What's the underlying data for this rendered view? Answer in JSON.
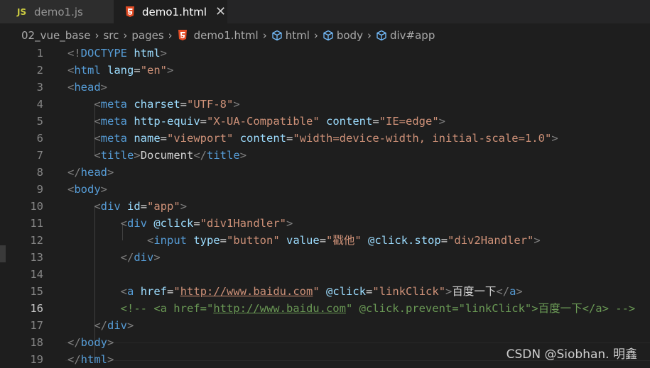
{
  "tabs": [
    {
      "icon": "JS",
      "label": "demo1.js"
    },
    {
      "icon": "html5-icon",
      "label": "demo1.html"
    }
  ],
  "breadcrumb": [
    "02_vue_base",
    "src",
    "pages",
    "demo1.html",
    "html",
    "body",
    "div#app"
  ],
  "line_numbers": [
    "1",
    "2",
    "3",
    "4",
    "5",
    "6",
    "7",
    "8",
    "9",
    "10",
    "11",
    "12",
    "13",
    "14",
    "15",
    "16",
    "17",
    "18",
    "19"
  ],
  "current_line": 16,
  "code_lines": [
    [
      [
        "t-punc",
        "<!"
      ],
      [
        "t-tag",
        "DOCTYPE"
      ],
      [
        "t-text",
        " "
      ],
      [
        "t-attr",
        "html"
      ],
      [
        "t-punc",
        ">"
      ]
    ],
    [
      [
        "t-punc",
        "<"
      ],
      [
        "t-tag",
        "html"
      ],
      [
        "t-text",
        " "
      ],
      [
        "t-attr",
        "lang"
      ],
      [
        "t-text",
        "="
      ],
      [
        "t-str",
        "\"en\""
      ],
      [
        "t-punc",
        ">"
      ]
    ],
    [
      [
        "t-punc",
        "<"
      ],
      [
        "t-tag",
        "head"
      ],
      [
        "t-punc",
        ">"
      ]
    ],
    [
      [
        "t-text",
        "    "
      ],
      [
        "t-punc",
        "<"
      ],
      [
        "t-tag",
        "meta"
      ],
      [
        "t-text",
        " "
      ],
      [
        "t-attr",
        "charset"
      ],
      [
        "t-text",
        "="
      ],
      [
        "t-str",
        "\"UTF-8\""
      ],
      [
        "t-punc",
        ">"
      ]
    ],
    [
      [
        "t-text",
        "    "
      ],
      [
        "t-punc",
        "<"
      ],
      [
        "t-tag",
        "meta"
      ],
      [
        "t-text",
        " "
      ],
      [
        "t-attr",
        "http-equiv"
      ],
      [
        "t-text",
        "="
      ],
      [
        "t-str",
        "\"X-UA-Compatible\""
      ],
      [
        "t-text",
        " "
      ],
      [
        "t-attr",
        "content"
      ],
      [
        "t-text",
        "="
      ],
      [
        "t-str",
        "\"IE=edge\""
      ],
      [
        "t-punc",
        ">"
      ]
    ],
    [
      [
        "t-text",
        "    "
      ],
      [
        "t-punc",
        "<"
      ],
      [
        "t-tag",
        "meta"
      ],
      [
        "t-text",
        " "
      ],
      [
        "t-attr",
        "name"
      ],
      [
        "t-text",
        "="
      ],
      [
        "t-str",
        "\"viewport\""
      ],
      [
        "t-text",
        " "
      ],
      [
        "t-attr",
        "content"
      ],
      [
        "t-text",
        "="
      ],
      [
        "t-str",
        "\"width=device-width, initial-scale=1.0\""
      ],
      [
        "t-punc",
        ">"
      ]
    ],
    [
      [
        "t-text",
        "    "
      ],
      [
        "t-punc",
        "<"
      ],
      [
        "t-tag",
        "title"
      ],
      [
        "t-punc",
        ">"
      ],
      [
        "t-text",
        "Document"
      ],
      [
        "t-punc",
        "</"
      ],
      [
        "t-tag",
        "title"
      ],
      [
        "t-punc",
        ">"
      ]
    ],
    [
      [
        "t-punc",
        "</"
      ],
      [
        "t-tag",
        "head"
      ],
      [
        "t-punc",
        ">"
      ]
    ],
    [
      [
        "t-punc",
        "<"
      ],
      [
        "t-tag",
        "body"
      ],
      [
        "t-punc",
        ">"
      ]
    ],
    [
      [
        "t-text",
        "    "
      ],
      [
        "t-punc",
        "<"
      ],
      [
        "t-tag",
        "div"
      ],
      [
        "t-text",
        " "
      ],
      [
        "t-attr",
        "id"
      ],
      [
        "t-text",
        "="
      ],
      [
        "t-str",
        "\"app\""
      ],
      [
        "t-punc",
        ">"
      ]
    ],
    [
      [
        "t-text",
        "        "
      ],
      [
        "t-punc",
        "<"
      ],
      [
        "t-tag",
        "div"
      ],
      [
        "t-text",
        " "
      ],
      [
        "t-attr",
        "@click"
      ],
      [
        "t-text",
        "="
      ],
      [
        "t-str",
        "\"div1Handler\""
      ],
      [
        "t-punc",
        ">"
      ]
    ],
    [
      [
        "t-text",
        "            "
      ],
      [
        "t-punc",
        "<"
      ],
      [
        "t-tag",
        "input"
      ],
      [
        "t-text",
        " "
      ],
      [
        "t-attr",
        "type"
      ],
      [
        "t-text",
        "="
      ],
      [
        "t-str",
        "\"button\""
      ],
      [
        "t-text",
        " "
      ],
      [
        "t-attr",
        "value"
      ],
      [
        "t-text",
        "="
      ],
      [
        "t-str",
        "\"戳他\""
      ],
      [
        "t-text",
        " "
      ],
      [
        "t-attr",
        "@click.stop"
      ],
      [
        "t-text",
        "="
      ],
      [
        "t-str",
        "\"div2Handler\""
      ],
      [
        "t-punc",
        ">"
      ]
    ],
    [
      [
        "t-text",
        "        "
      ],
      [
        "t-punc",
        "</"
      ],
      [
        "t-tag",
        "div"
      ],
      [
        "t-punc",
        ">"
      ]
    ],
    [],
    [
      [
        "t-text",
        "        "
      ],
      [
        "t-punc",
        "<"
      ],
      [
        "t-tag",
        "a"
      ],
      [
        "t-text",
        " "
      ],
      [
        "t-attr",
        "href"
      ],
      [
        "t-text",
        "="
      ],
      [
        "t-str",
        "\""
      ],
      [
        "t-str t-link",
        "http://www.baidu.com"
      ],
      [
        "t-str",
        "\""
      ],
      [
        "t-text",
        " "
      ],
      [
        "t-attr",
        "@click"
      ],
      [
        "t-text",
        "="
      ],
      [
        "t-str",
        "\"linkClick\""
      ],
      [
        "t-punc",
        ">"
      ],
      [
        "t-text",
        "百度一下"
      ],
      [
        "t-punc",
        "</"
      ],
      [
        "t-tag",
        "a"
      ],
      [
        "t-punc",
        ">"
      ]
    ],
    [
      [
        "t-text",
        "        "
      ],
      [
        "t-com",
        "<!-- <a href=\""
      ],
      [
        "t-com t-link",
        "http://www.baidu.com"
      ],
      [
        "t-com",
        "\" @click.prevent=\"linkClick\">百度一下</a> -->"
      ]
    ],
    [
      [
        "t-text",
        "    "
      ],
      [
        "t-punc",
        "</"
      ],
      [
        "t-tag",
        "div"
      ],
      [
        "t-punc",
        ">"
      ]
    ],
    [
      [
        "t-punc",
        "</"
      ],
      [
        "t-tag",
        "body"
      ],
      [
        "t-punc",
        ">"
      ]
    ],
    [
      [
        "t-punc",
        "</"
      ],
      [
        "t-tag",
        "html"
      ],
      [
        "t-punc",
        ">"
      ]
    ]
  ],
  "watermark": "CSDN @Siobhan. 明鑫"
}
